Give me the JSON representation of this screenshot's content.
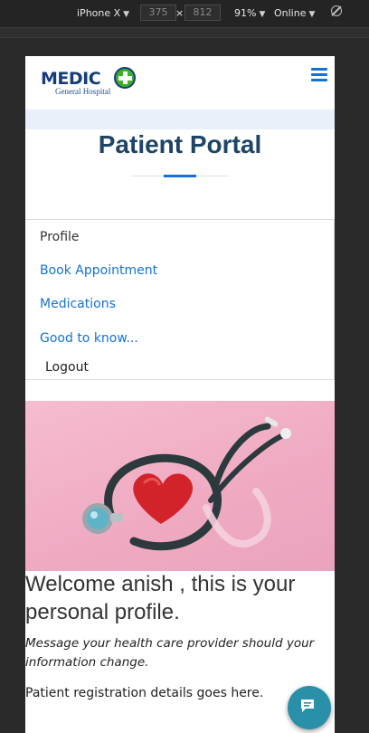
{
  "devtools": {
    "device": "iPhone X",
    "width": "375",
    "height": "812",
    "dimension_separator": "×",
    "zoom": "91%",
    "network": "Online",
    "caret": "▼",
    "icons": {
      "rotate": "rotate-icon"
    }
  },
  "site": {
    "logo": {
      "name": "MEDIC",
      "subtitle": "General Hospital"
    },
    "icons": {
      "menu": "hamburger-menu-icon",
      "logo_cross": "medical-cross-icon"
    },
    "colors": {
      "brand_blue": "#153d7a",
      "link_blue": "#1572d3",
      "title": "#1e4466",
      "cross_green": "#3fae2a",
      "chat": "#2a8fa8"
    }
  },
  "page": {
    "title": "Patient Portal"
  },
  "nav": {
    "profile": "Profile",
    "book": "Book Appointment",
    "medications": "Medications",
    "good_to_know": "Good to know...",
    "logout": "Logout"
  },
  "content": {
    "hero_image": "stethoscope-heart-image",
    "welcome": "Welcome anish , this is your personal profile.",
    "notice": "Message your health care provider should your information change.",
    "details": "Patient registration details goes here."
  },
  "chat": {
    "icon": "chat-bubble-icon"
  }
}
